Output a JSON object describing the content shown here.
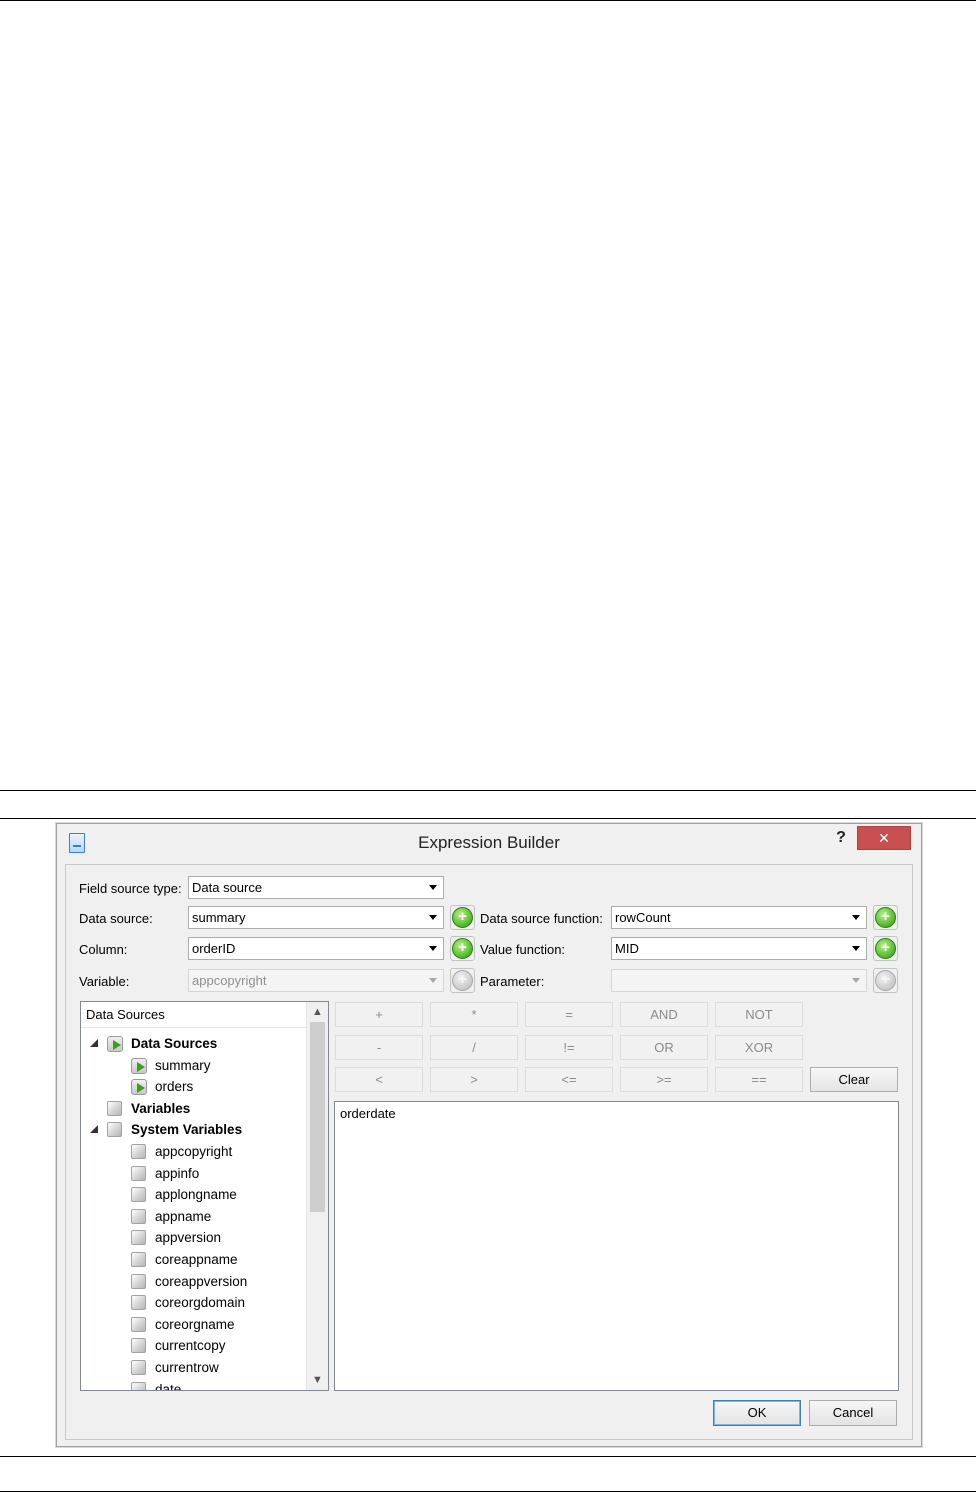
{
  "dialog": {
    "title": "Expression Builder",
    "help_label": "?",
    "close_label": "✕"
  },
  "form": {
    "field_source_type": {
      "label": "Field source type:",
      "value": "Data source"
    },
    "data_source": {
      "label": "Data source:",
      "value": "summary"
    },
    "column": {
      "label": "Column:",
      "value": "orderID"
    },
    "variable": {
      "label": "Variable:",
      "value": "appcopyright"
    },
    "data_source_function": {
      "label": "Data source function:",
      "value": "rowCount"
    },
    "value_function": {
      "label": "Value function:",
      "value": "MID"
    },
    "parameter": {
      "label": "Parameter:",
      "value": ""
    },
    "add_label": "+"
  },
  "tree": {
    "header": "Data Sources",
    "rows": [
      {
        "label": "Data Sources",
        "bold": true,
        "level": 0,
        "expanded": true,
        "icon": "datasource-icon"
      },
      {
        "label": "summary",
        "bold": false,
        "level": 1,
        "icon": "datasource-icon"
      },
      {
        "label": "orders",
        "bold": false,
        "level": 1,
        "icon": "datasource-icon"
      },
      {
        "label": "Variables",
        "bold": true,
        "level": 0,
        "icon": "cube-icon"
      },
      {
        "label": "System Variables",
        "bold": true,
        "level": 0,
        "expanded": true,
        "icon": "cube-icon"
      },
      {
        "label": "appcopyright",
        "bold": false,
        "level": 1,
        "icon": "cube-icon"
      },
      {
        "label": "appinfo",
        "bold": false,
        "level": 1,
        "icon": "cube-icon"
      },
      {
        "label": "applongname",
        "bold": false,
        "level": 1,
        "icon": "cube-icon"
      },
      {
        "label": "appname",
        "bold": false,
        "level": 1,
        "icon": "cube-icon"
      },
      {
        "label": "appversion",
        "bold": false,
        "level": 1,
        "icon": "cube-icon"
      },
      {
        "label": "coreappname",
        "bold": false,
        "level": 1,
        "icon": "cube-icon"
      },
      {
        "label": "coreappversion",
        "bold": false,
        "level": 1,
        "icon": "cube-icon"
      },
      {
        "label": "coreorgdomain",
        "bold": false,
        "level": 1,
        "icon": "cube-icon"
      },
      {
        "label": "coreorgname",
        "bold": false,
        "level": 1,
        "icon": "cube-icon"
      },
      {
        "label": "currentcopy",
        "bold": false,
        "level": 1,
        "icon": "cube-icon"
      },
      {
        "label": "currentrow",
        "bold": false,
        "level": 1,
        "icon": "cube-icon"
      },
      {
        "label": "date",
        "bold": false,
        "level": 1,
        "icon": "cube-icon"
      }
    ]
  },
  "operators": {
    "row1": [
      "+",
      "*",
      "=",
      "AND",
      "NOT"
    ],
    "row2": [
      "-",
      "/",
      "!=",
      "OR",
      "XOR"
    ],
    "row3": [
      "<",
      ">",
      "<=",
      ">=",
      "=="
    ],
    "clear": "Clear"
  },
  "expression": {
    "value": "orderdate"
  },
  "buttons": {
    "ok": "OK",
    "cancel": "Cancel"
  },
  "colors": {
    "close": "#c75050",
    "add_green": "#4fb52a",
    "primary_border": "#3c7fb1"
  }
}
